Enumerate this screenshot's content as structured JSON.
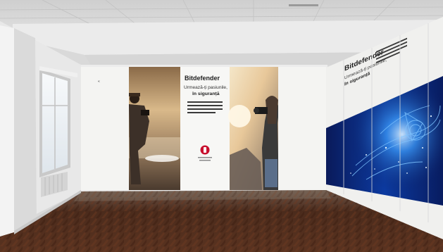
{
  "scene": {
    "description_type": "architectural visualization of exhibition room with printed wall graphics"
  },
  "wall_graphics": {
    "center_panel": {
      "brand": "Bitdefender",
      "tagline_line1": "Urmează-ți pasiunile,",
      "tagline_line2": "în siguranță"
    },
    "side_wall": {
      "brand": "Bitdefender",
      "tagline_line1": "Urmează-ți pasiunile,",
      "tagline_line2": "în siguranță"
    },
    "left_panel_mark": "«"
  },
  "colors": {
    "brand_red": "#c8102e",
    "wall_white": "#f2f2f0",
    "floor_dark": "#4a2a1a",
    "cyber_blue": "#0a2a8a"
  }
}
